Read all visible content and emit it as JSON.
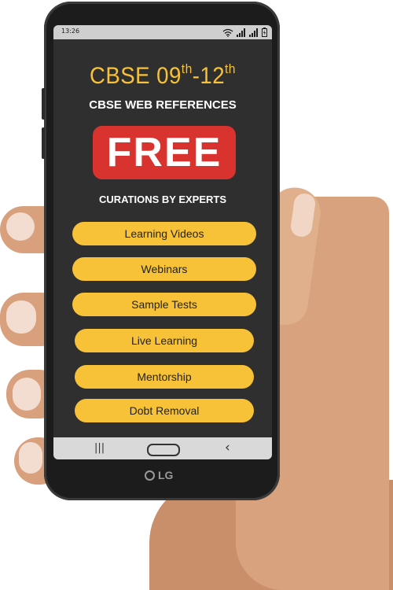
{
  "status_bar": {
    "time": "13:26",
    "icons": [
      "wifi-icon",
      "signal-icon",
      "signal-icon",
      "battery-icon"
    ]
  },
  "header": {
    "title_main": "CBSE 09",
    "title_sup1": "th",
    "title_mid": "-12",
    "title_sup2": "th",
    "subtitle": "CBSE WEB REFERENCES"
  },
  "free_button": {
    "label": "FREE"
  },
  "tagline": "CURATIONS BY EXPERTS",
  "menu": {
    "items": [
      {
        "label": "Learning Videos"
      },
      {
        "label": "Webinars"
      },
      {
        "label": "Sample Tests"
      },
      {
        "label": "Live Learning"
      },
      {
        "label": "Mentorship"
      },
      {
        "label": "Dobt Removal"
      }
    ]
  },
  "nav_bar": {
    "recent_glyph": "|||",
    "back_glyph": "‹"
  },
  "device": {
    "brand": "LG"
  },
  "colors": {
    "accent": "#f7c237",
    "free_red": "#d8332f",
    "screen_bg": "#2f2f2f"
  }
}
